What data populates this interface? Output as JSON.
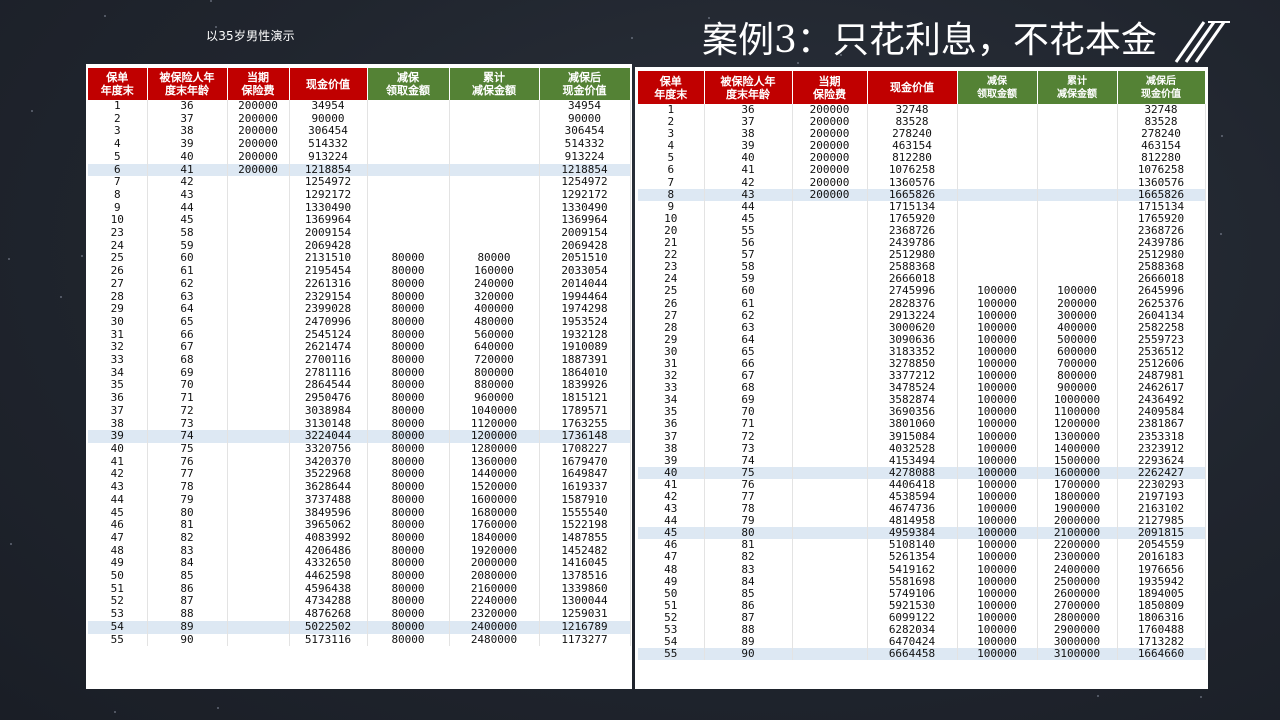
{
  "subtitle": "以35岁男性演示",
  "title": "案例3：只花利息，不花本金",
  "left_table": {
    "headers": [
      {
        "l1": "保单",
        "l2": "年度末",
        "color": "red"
      },
      {
        "l1": "被保险人年",
        "l2": "度末年龄",
        "color": "red"
      },
      {
        "l1": "当期",
        "l2": "保险费",
        "color": "red"
      },
      {
        "l1": "现金价值",
        "l2": "",
        "color": "red"
      },
      {
        "l1": "减保",
        "l2": "领取金额",
        "color": "green"
      },
      {
        "l1": "累计",
        "l2": "减保金额",
        "color": "green"
      },
      {
        "l1": "减保后",
        "l2": "现金价值",
        "color": "green"
      }
    ],
    "rows": [
      [
        "1",
        "36",
        "200000",
        "34954",
        "",
        "",
        "34954"
      ],
      [
        "2",
        "37",
        "200000",
        "90000",
        "",
        "",
        "90000"
      ],
      [
        "3",
        "38",
        "200000",
        "306454",
        "",
        "",
        "306454"
      ],
      [
        "4",
        "39",
        "200000",
        "514332",
        "",
        "",
        "514332"
      ],
      [
        "5",
        "40",
        "200000",
        "913224",
        "",
        "",
        "913224"
      ],
      [
        "6",
        "41",
        "200000",
        "1218854",
        "",
        "",
        "1218854"
      ],
      [
        "7",
        "42",
        "",
        "1254972",
        "",
        "",
        "1254972"
      ],
      [
        "8",
        "43",
        "",
        "1292172",
        "",
        "",
        "1292172"
      ],
      [
        "9",
        "44",
        "",
        "1330490",
        "",
        "",
        "1330490"
      ],
      [
        "10",
        "45",
        "",
        "1369964",
        "",
        "",
        "1369964"
      ],
      [
        "23",
        "58",
        "",
        "2009154",
        "",
        "",
        "2009154"
      ],
      [
        "24",
        "59",
        "",
        "2069428",
        "",
        "",
        "2069428"
      ],
      [
        "25",
        "60",
        "",
        "2131510",
        "80000",
        "80000",
        "2051510"
      ],
      [
        "26",
        "61",
        "",
        "2195454",
        "80000",
        "160000",
        "2033054"
      ],
      [
        "27",
        "62",
        "",
        "2261316",
        "80000",
        "240000",
        "2014044"
      ],
      [
        "28",
        "63",
        "",
        "2329154",
        "80000",
        "320000",
        "1994464"
      ],
      [
        "29",
        "64",
        "",
        "2399028",
        "80000",
        "400000",
        "1974298"
      ],
      [
        "30",
        "65",
        "",
        "2470996",
        "80000",
        "480000",
        "1953524"
      ],
      [
        "31",
        "66",
        "",
        "2545124",
        "80000",
        "560000",
        "1932128"
      ],
      [
        "32",
        "67",
        "",
        "2621474",
        "80000",
        "640000",
        "1910089"
      ],
      [
        "33",
        "68",
        "",
        "2700116",
        "80000",
        "720000",
        "1887391"
      ],
      [
        "34",
        "69",
        "",
        "2781116",
        "80000",
        "800000",
        "1864010"
      ],
      [
        "35",
        "70",
        "",
        "2864544",
        "80000",
        "880000",
        "1839926"
      ],
      [
        "36",
        "71",
        "",
        "2950476",
        "80000",
        "960000",
        "1815121"
      ],
      [
        "37",
        "72",
        "",
        "3038984",
        "80000",
        "1040000",
        "1789571"
      ],
      [
        "38",
        "73",
        "",
        "3130148",
        "80000",
        "1120000",
        "1763255"
      ],
      [
        "39",
        "74",
        "",
        "3224044",
        "80000",
        "1200000",
        "1736148"
      ],
      [
        "40",
        "75",
        "",
        "3320756",
        "80000",
        "1280000",
        "1708227"
      ],
      [
        "41",
        "76",
        "",
        "3420370",
        "80000",
        "1360000",
        "1679470"
      ],
      [
        "42",
        "77",
        "",
        "3522968",
        "80000",
        "1440000",
        "1649847"
      ],
      [
        "43",
        "78",
        "",
        "3628644",
        "80000",
        "1520000",
        "1619337"
      ],
      [
        "44",
        "79",
        "",
        "3737488",
        "80000",
        "1600000",
        "1587910"
      ],
      [
        "45",
        "80",
        "",
        "3849596",
        "80000",
        "1680000",
        "1555540"
      ],
      [
        "46",
        "81",
        "",
        "3965062",
        "80000",
        "1760000",
        "1522198"
      ],
      [
        "47",
        "82",
        "",
        "4083992",
        "80000",
        "1840000",
        "1487855"
      ],
      [
        "48",
        "83",
        "",
        "4206486",
        "80000",
        "1920000",
        "1452482"
      ],
      [
        "49",
        "84",
        "",
        "4332650",
        "80000",
        "2000000",
        "1416045"
      ],
      [
        "50",
        "85",
        "",
        "4462598",
        "80000",
        "2080000",
        "1378516"
      ],
      [
        "51",
        "86",
        "",
        "4596438",
        "80000",
        "2160000",
        "1339860"
      ],
      [
        "52",
        "87",
        "",
        "4734288",
        "80000",
        "2240000",
        "1300044"
      ],
      [
        "53",
        "88",
        "",
        "4876268",
        "80000",
        "2320000",
        "1259031"
      ],
      [
        "54",
        "89",
        "",
        "5022502",
        "80000",
        "2400000",
        "1216789"
      ],
      [
        "55",
        "90",
        "",
        "5173116",
        "80000",
        "2480000",
        "1173277"
      ]
    ],
    "highlight_rows": [
      5,
      26,
      41
    ]
  },
  "right_table": {
    "headers": [
      {
        "l1": "保单",
        "l2": "年度末",
        "color": "red"
      },
      {
        "l1": "被保险人年",
        "l2": "度末年龄",
        "color": "red"
      },
      {
        "l1": "当期",
        "l2": "保险费",
        "color": "red"
      },
      {
        "l1": "现金价值",
        "l2": "",
        "color": "red"
      },
      {
        "l1": "减保",
        "l2": "领取金额",
        "color": "green"
      },
      {
        "l1": "累计",
        "l2": "减保金额",
        "color": "green"
      },
      {
        "l1": "减保后",
        "l2": "现金价值",
        "color": "green"
      }
    ],
    "rows": [
      [
        "1",
        "36",
        "200000",
        "32748",
        "",
        "",
        "32748"
      ],
      [
        "2",
        "37",
        "200000",
        "83528",
        "",
        "",
        "83528"
      ],
      [
        "3",
        "38",
        "200000",
        "278240",
        "",
        "",
        "278240"
      ],
      [
        "4",
        "39",
        "200000",
        "463154",
        "",
        "",
        "463154"
      ],
      [
        "5",
        "40",
        "200000",
        "812280",
        "",
        "",
        "812280"
      ],
      [
        "6",
        "41",
        "200000",
        "1076258",
        "",
        "",
        "1076258"
      ],
      [
        "7",
        "42",
        "200000",
        "1360576",
        "",
        "",
        "1360576"
      ],
      [
        "8",
        "43",
        "200000",
        "1665826",
        "",
        "",
        "1665826"
      ],
      [
        "9",
        "44",
        "",
        "1715134",
        "",
        "",
        "1715134"
      ],
      [
        "10",
        "45",
        "",
        "1765920",
        "",
        "",
        "1765920"
      ],
      [
        "20",
        "55",
        "",
        "2368726",
        "",
        "",
        "2368726"
      ],
      [
        "21",
        "56",
        "",
        "2439786",
        "",
        "",
        "2439786"
      ],
      [
        "22",
        "57",
        "",
        "2512980",
        "",
        "",
        "2512980"
      ],
      [
        "23",
        "58",
        "",
        "2588368",
        "",
        "",
        "2588368"
      ],
      [
        "24",
        "59",
        "",
        "2666018",
        "",
        "",
        "2666018"
      ],
      [
        "25",
        "60",
        "",
        "2745996",
        "100000",
        "100000",
        "2645996"
      ],
      [
        "26",
        "61",
        "",
        "2828376",
        "100000",
        "200000",
        "2625376"
      ],
      [
        "27",
        "62",
        "",
        "2913224",
        "100000",
        "300000",
        "2604134"
      ],
      [
        "28",
        "63",
        "",
        "3000620",
        "100000",
        "400000",
        "2582258"
      ],
      [
        "29",
        "64",
        "",
        "3090636",
        "100000",
        "500000",
        "2559723"
      ],
      [
        "30",
        "65",
        "",
        "3183352",
        "100000",
        "600000",
        "2536512"
      ],
      [
        "31",
        "66",
        "",
        "3278850",
        "100000",
        "700000",
        "2512606"
      ],
      [
        "32",
        "67",
        "",
        "3377212",
        "100000",
        "800000",
        "2487981"
      ],
      [
        "33",
        "68",
        "",
        "3478524",
        "100000",
        "900000",
        "2462617"
      ],
      [
        "34",
        "69",
        "",
        "3582874",
        "100000",
        "1000000",
        "2436492"
      ],
      [
        "35",
        "70",
        "",
        "3690356",
        "100000",
        "1100000",
        "2409584"
      ],
      [
        "36",
        "71",
        "",
        "3801060",
        "100000",
        "1200000",
        "2381867"
      ],
      [
        "37",
        "72",
        "",
        "3915084",
        "100000",
        "1300000",
        "2353318"
      ],
      [
        "38",
        "73",
        "",
        "4032528",
        "100000",
        "1400000",
        "2323912"
      ],
      [
        "39",
        "74",
        "",
        "4153494",
        "100000",
        "1500000",
        "2293624"
      ],
      [
        "40",
        "75",
        "",
        "4278088",
        "100000",
        "1600000",
        "2262427"
      ],
      [
        "41",
        "76",
        "",
        "4406418",
        "100000",
        "1700000",
        "2230293"
      ],
      [
        "42",
        "77",
        "",
        "4538594",
        "100000",
        "1800000",
        "2197193"
      ],
      [
        "43",
        "78",
        "",
        "4674736",
        "100000",
        "1900000",
        "2163102"
      ],
      [
        "44",
        "79",
        "",
        "4814958",
        "100000",
        "2000000",
        "2127985"
      ],
      [
        "45",
        "80",
        "",
        "4959384",
        "100000",
        "2100000",
        "2091815"
      ],
      [
        "46",
        "81",
        "",
        "5108140",
        "100000",
        "2200000",
        "2054559"
      ],
      [
        "47",
        "82",
        "",
        "5261354",
        "100000",
        "2300000",
        "2016183"
      ],
      [
        "48",
        "83",
        "",
        "5419162",
        "100000",
        "2400000",
        "1976656"
      ],
      [
        "49",
        "84",
        "",
        "5581698",
        "100000",
        "2500000",
        "1935942"
      ],
      [
        "50",
        "85",
        "",
        "5749106",
        "100000",
        "2600000",
        "1894005"
      ],
      [
        "51",
        "86",
        "",
        "5921530",
        "100000",
        "2700000",
        "1850809"
      ],
      [
        "52",
        "87",
        "",
        "6099122",
        "100000",
        "2800000",
        "1806316"
      ],
      [
        "53",
        "88",
        "",
        "6282034",
        "100000",
        "2900000",
        "1760488"
      ],
      [
        "54",
        "89",
        "",
        "6470424",
        "100000",
        "3000000",
        "1713282"
      ],
      [
        "55",
        "90",
        "",
        "6664458",
        "100000",
        "3100000",
        "1664660"
      ]
    ],
    "highlight_rows": [
      7,
      30,
      35,
      45
    ]
  },
  "colors": {
    "header_red": "#c00000",
    "header_green": "#548235",
    "row_highlight": "#dde8f3",
    "background": "#22272f"
  }
}
